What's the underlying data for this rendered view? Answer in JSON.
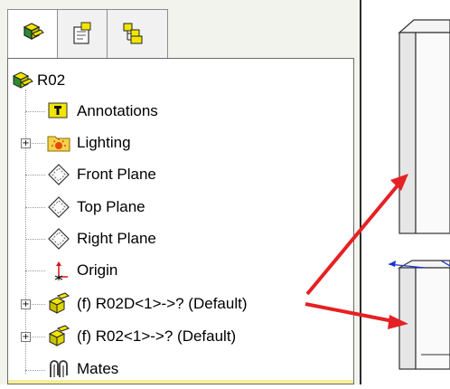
{
  "tabs": [
    {
      "name": "FeatureManager design tree",
      "icon": "feature-tree-icon",
      "active": true
    },
    {
      "name": "PropertyManager",
      "icon": "property-manager-icon",
      "active": false
    },
    {
      "name": "ConfigurationManager",
      "icon": "configuration-manager-icon",
      "active": false
    }
  ],
  "tree": {
    "root": {
      "label": "R02",
      "icon": "assembly-icon"
    },
    "items": [
      {
        "label": "Annotations",
        "icon": "annotations-icon",
        "expandable": false
      },
      {
        "label": "Lighting",
        "icon": "lighting-folder-icon",
        "expandable": true
      },
      {
        "label": "Front Plane",
        "icon": "plane-icon",
        "expandable": false
      },
      {
        "label": "Top Plane",
        "icon": "plane-icon",
        "expandable": false
      },
      {
        "label": "Right Plane",
        "icon": "plane-icon",
        "expandable": false
      },
      {
        "label": "Origin",
        "icon": "origin-icon",
        "expandable": false
      },
      {
        "label": "(f) R02D<1>->? (Default)",
        "icon": "part-icon",
        "expandable": true
      },
      {
        "label": "(f) R02<1>->? (Default)",
        "icon": "part-icon",
        "expandable": true
      },
      {
        "label": "Mates",
        "icon": "mates-icon",
        "expandable": false
      }
    ]
  },
  "colors": {
    "arrow": "#e52124",
    "part_yellow": "#f2e600",
    "highlight_bar": "#f5ef9c"
  }
}
